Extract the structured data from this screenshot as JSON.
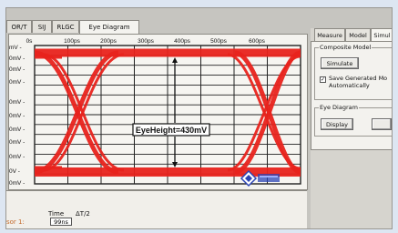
{
  "tabs": [
    "OR/T",
    "SIJ",
    "RLGC",
    "Eye Diagram"
  ],
  "active_tab": "Eye Diagram",
  "plot": {
    "x_ticks": [
      "0s",
      "100ps",
      "200ps",
      "300ps",
      "400ps",
      "500ps",
      "600ps"
    ],
    "y_ticks": [
      "mV",
      "0mV",
      "0mV",
      "0mV",
      "0mV",
      "0mV",
      "0mV",
      "0mV",
      "0mV",
      "0V",
      "0mV"
    ],
    "annotation": "EyeHeight=430mV"
  },
  "bottom": {
    "time_label": "Time",
    "delta_label": "ΔT/2",
    "cursor_label": "sor 1:",
    "cursor_time": "99ns"
  },
  "right_panel": {
    "tabs": [
      "Measure",
      "Model",
      "Simul"
    ],
    "active_tab": "Simul",
    "composite_group": "Composite Model",
    "simulate_button": "Simulate",
    "save_checkbox_line1": "Save Generated Mo",
    "save_checkbox_line2": "Automatically",
    "save_checked": true,
    "eye_group": "Eye Diagram",
    "display_button": "Display"
  },
  "colors": {
    "eye_trace": "#e8231c",
    "grid": "#222222",
    "plot_bg": "#f4f3ef",
    "cursor_text": "#c46a2c"
  },
  "icons": [
    "logo-icon"
  ]
}
